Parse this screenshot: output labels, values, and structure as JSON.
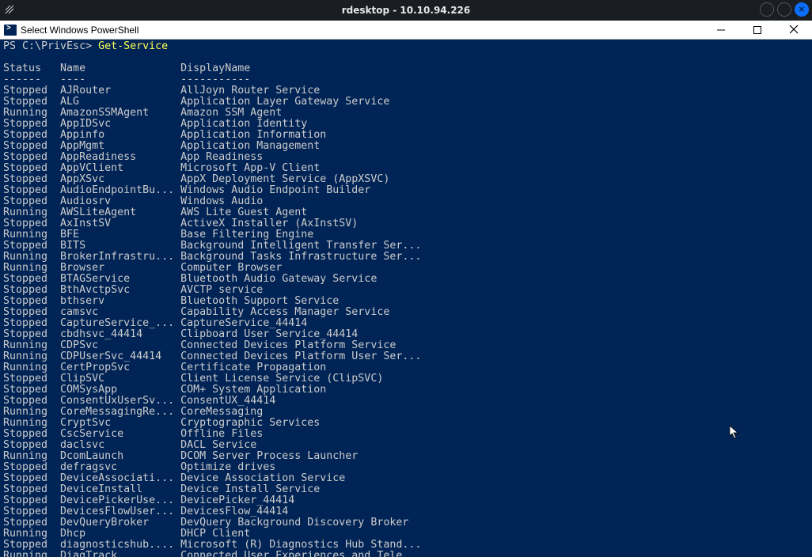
{
  "outer": {
    "title": "rdesktop - 10.10.94.226"
  },
  "window": {
    "title": "Select Windows PowerShell"
  },
  "prompt": {
    "path": "PS C:\\PrivEsc> ",
    "command": "Get-Service"
  },
  "headers": {
    "status": "Status",
    "name": "Name",
    "display": "DisplayName"
  },
  "divider": {
    "status": "------",
    "name": "----",
    "display": "-----------"
  },
  "services": [
    {
      "status": "Stopped",
      "name": "AJRouter",
      "display": "AllJoyn Router Service"
    },
    {
      "status": "Stopped",
      "name": "ALG",
      "display": "Application Layer Gateway Service"
    },
    {
      "status": "Running",
      "name": "AmazonSSMAgent",
      "display": "Amazon SSM Agent"
    },
    {
      "status": "Stopped",
      "name": "AppIDSvc",
      "display": "Application Identity"
    },
    {
      "status": "Stopped",
      "name": "Appinfo",
      "display": "Application Information"
    },
    {
      "status": "Stopped",
      "name": "AppMgmt",
      "display": "Application Management"
    },
    {
      "status": "Stopped",
      "name": "AppReadiness",
      "display": "App Readiness"
    },
    {
      "status": "Stopped",
      "name": "AppVClient",
      "display": "Microsoft App-V Client"
    },
    {
      "status": "Stopped",
      "name": "AppXSvc",
      "display": "AppX Deployment Service (AppXSVC)"
    },
    {
      "status": "Stopped",
      "name": "AudioEndpointBu...",
      "display": "Windows Audio Endpoint Builder"
    },
    {
      "status": "Stopped",
      "name": "Audiosrv",
      "display": "Windows Audio"
    },
    {
      "status": "Running",
      "name": "AWSLiteAgent",
      "display": "AWS Lite Guest Agent"
    },
    {
      "status": "Stopped",
      "name": "AxInstSV",
      "display": "ActiveX Installer (AxInstSV)"
    },
    {
      "status": "Running",
      "name": "BFE",
      "display": "Base Filtering Engine"
    },
    {
      "status": "Stopped",
      "name": "BITS",
      "display": "Background Intelligent Transfer Ser..."
    },
    {
      "status": "Running",
      "name": "BrokerInfrastru...",
      "display": "Background Tasks Infrastructure Ser..."
    },
    {
      "status": "Running",
      "name": "Browser",
      "display": "Computer Browser"
    },
    {
      "status": "Stopped",
      "name": "BTAGService",
      "display": "Bluetooth Audio Gateway Service"
    },
    {
      "status": "Stopped",
      "name": "BthAvctpSvc",
      "display": "AVCTP service"
    },
    {
      "status": "Stopped",
      "name": "bthserv",
      "display": "Bluetooth Support Service"
    },
    {
      "status": "Stopped",
      "name": "camsvc",
      "display": "Capability Access Manager Service"
    },
    {
      "status": "Stopped",
      "name": "CaptureService_...",
      "display": "CaptureService_44414"
    },
    {
      "status": "Stopped",
      "name": "cbdhsvc_44414",
      "display": "Clipboard User Service_44414"
    },
    {
      "status": "Running",
      "name": "CDPSvc",
      "display": "Connected Devices Platform Service"
    },
    {
      "status": "Running",
      "name": "CDPUserSvc_44414",
      "display": "Connected Devices Platform User Ser..."
    },
    {
      "status": "Running",
      "name": "CertPropSvc",
      "display": "Certificate Propagation"
    },
    {
      "status": "Stopped",
      "name": "ClipSVC",
      "display": "Client License Service (ClipSVC)"
    },
    {
      "status": "Stopped",
      "name": "COMSysApp",
      "display": "COM+ System Application"
    },
    {
      "status": "Stopped",
      "name": "ConsentUxUserSv...",
      "display": "ConsentUX_44414"
    },
    {
      "status": "Running",
      "name": "CoreMessagingRe...",
      "display": "CoreMessaging"
    },
    {
      "status": "Running",
      "name": "CryptSvc",
      "display": "Cryptographic Services"
    },
    {
      "status": "Stopped",
      "name": "CscService",
      "display": "Offline Files"
    },
    {
      "status": "Stopped",
      "name": "daclsvc",
      "display": "DACL Service"
    },
    {
      "status": "Running",
      "name": "DcomLaunch",
      "display": "DCOM Server Process Launcher"
    },
    {
      "status": "Stopped",
      "name": "defragsvc",
      "display": "Optimize drives"
    },
    {
      "status": "Stopped",
      "name": "DeviceAssociati...",
      "display": "Device Association Service"
    },
    {
      "status": "Stopped",
      "name": "DeviceInstall",
      "display": "Device Install Service"
    },
    {
      "status": "Stopped",
      "name": "DevicePickerUse...",
      "display": "DevicePicker_44414"
    },
    {
      "status": "Stopped",
      "name": "DevicesFlowUser...",
      "display": "DevicesFlow_44414"
    },
    {
      "status": "Stopped",
      "name": "DevQueryBroker",
      "display": "DevQuery Background Discovery Broker"
    },
    {
      "status": "Running",
      "name": "Dhcp",
      "display": "DHCP Client"
    },
    {
      "status": "Stopped",
      "name": "diagnosticshub....",
      "display": "Microsoft (R) Diagnostics Hub Stand..."
    },
    {
      "status": "Running",
      "name": "DiagTrack",
      "display": "Connected User Experiences and Tele"
    }
  ]
}
